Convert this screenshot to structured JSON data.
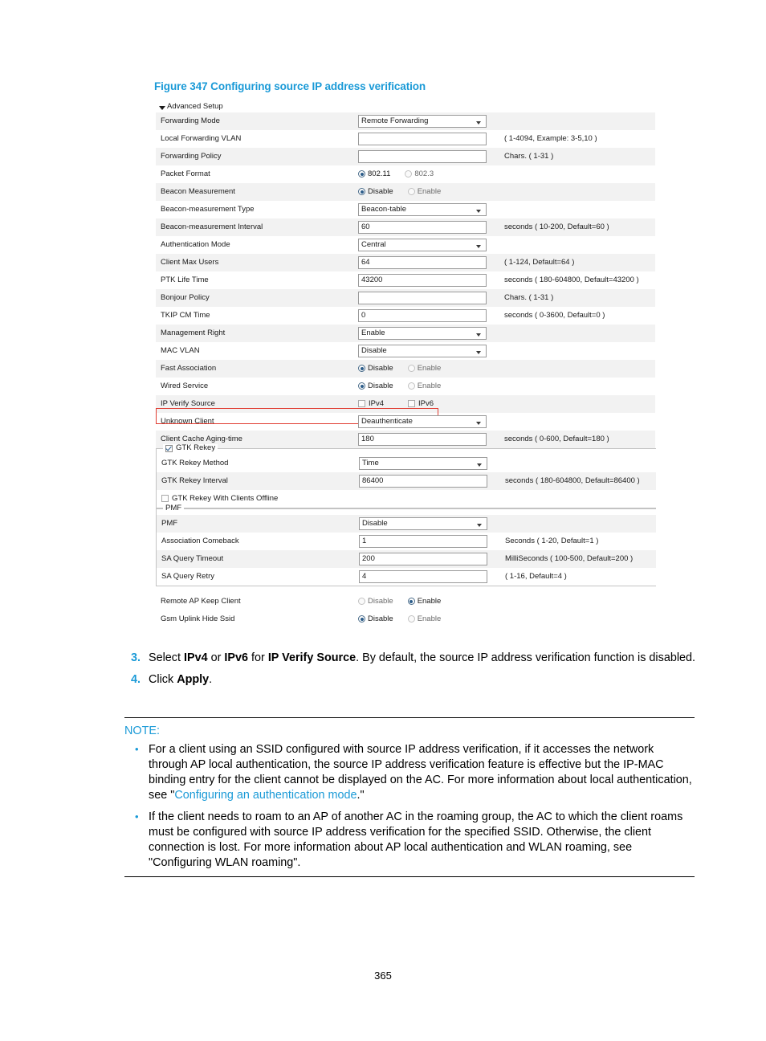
{
  "figure": {
    "caption": "Figure 347 Configuring source IP address verification"
  },
  "form": {
    "section_header": "Advanced Setup",
    "rows": [
      {
        "label": "Forwarding Mode",
        "control": "select",
        "value": "Remote Forwarding",
        "hint": ""
      },
      {
        "label": "Local Forwarding VLAN",
        "control": "text",
        "value": "",
        "hint": "( 1-4094, Example: 3-5,10 )"
      },
      {
        "label": "Forwarding Policy",
        "control": "text",
        "value": "",
        "hint": "Chars. ( 1-31 )"
      },
      {
        "label": "Packet Format",
        "control": "radio",
        "options": [
          "802.11",
          "802.3"
        ],
        "selected": "802.11",
        "hint": ""
      },
      {
        "label": "Beacon Measurement",
        "control": "radio",
        "options": [
          "Disable",
          "Enable"
        ],
        "selected": "Disable",
        "hint": ""
      },
      {
        "label": "Beacon-measurement Type",
        "control": "select",
        "value": "Beacon-table",
        "hint": ""
      },
      {
        "label": "Beacon-measurement Interval",
        "control": "text",
        "value": "60",
        "hint": "seconds ( 10-200, Default=60 )"
      },
      {
        "label": "Authentication Mode",
        "control": "select",
        "value": "Central",
        "hint": ""
      },
      {
        "label": "Client Max Users",
        "control": "text",
        "value": "64",
        "hint": "( 1-124, Default=64 )"
      },
      {
        "label": "PTK Life Time",
        "control": "text",
        "value": "43200",
        "hint": "seconds ( 180-604800, Default=43200 )"
      },
      {
        "label": "Bonjour Policy",
        "control": "text",
        "value": "",
        "hint": "Chars. ( 1-31 )"
      },
      {
        "label": "TKIP CM Time",
        "control": "text",
        "value": "0",
        "hint": "seconds ( 0-3600, Default=0 )"
      },
      {
        "label": "Management Right",
        "control": "select",
        "value": "Enable",
        "hint": ""
      },
      {
        "label": "MAC VLAN",
        "control": "select",
        "value": "Disable",
        "hint": ""
      },
      {
        "label": "Fast Association",
        "control": "radio",
        "options": [
          "Disable",
          "Enable"
        ],
        "selected": "Disable",
        "hint": ""
      },
      {
        "label": "Wired Service",
        "control": "radio",
        "options": [
          "Disable",
          "Enable"
        ],
        "selected": "Disable",
        "hint": ""
      },
      {
        "label": "IP Verify Source",
        "control": "checkbox",
        "options": [
          "IPv4",
          "IPv6"
        ],
        "checked": [],
        "hint": "",
        "highlighted": true
      },
      {
        "label": "Unknown Client",
        "control": "select",
        "value": "Deauthenticate",
        "hint": ""
      },
      {
        "label": "Client Cache Aging-time",
        "control": "text",
        "value": "180",
        "hint": "seconds ( 0-600, Default=180 )"
      }
    ],
    "gtk_rekey": {
      "legend": "GTK Rekey",
      "legend_checked": true,
      "rows": [
        {
          "label": "GTK Rekey Method",
          "control": "select",
          "value": "Time",
          "hint": ""
        },
        {
          "label": "GTK Rekey Interval",
          "control": "text",
          "value": "86400",
          "hint": "seconds ( 180-604800, Default=86400 )"
        }
      ],
      "offline_checkbox": {
        "label": "GTK Rekey With Clients Offline",
        "checked": false
      }
    },
    "pmf": {
      "legend": "PMF",
      "rows": [
        {
          "label": "PMF",
          "control": "select",
          "value": "Disable",
          "hint": ""
        },
        {
          "label": "Association Comeback",
          "control": "text",
          "value": "1",
          "hint": "Seconds ( 1-20, Default=1 )"
        },
        {
          "label": "SA Query Timeout",
          "control": "text",
          "value": "200",
          "hint": "MilliSeconds ( 100-500, Default=200 )"
        },
        {
          "label": "SA Query Retry",
          "control": "text",
          "value": "4",
          "hint": "( 1-16, Default=4 )"
        }
      ]
    },
    "tail_rows": [
      {
        "label": "Remote AP Keep Client",
        "control": "radio",
        "options": [
          "Disable",
          "Enable"
        ],
        "selected": "Enable"
      },
      {
        "label": "Gsm Uplink Hide Ssid",
        "control": "radio",
        "options": [
          "Disable",
          "Enable"
        ],
        "selected": "Disable"
      }
    ]
  },
  "steps": [
    {
      "num": "3.",
      "parts": [
        {
          "t": "Select ",
          "b": false
        },
        {
          "t": "IPv4",
          "b": true
        },
        {
          "t": " or ",
          "b": false
        },
        {
          "t": "IPv6",
          "b": true
        },
        {
          "t": " for ",
          "b": false
        },
        {
          "t": "IP Verify Source",
          "b": true
        },
        {
          "t": ". By default, the source IP address verification function is disabled.",
          "b": false
        }
      ]
    },
    {
      "num": "4.",
      "parts": [
        {
          "t": "Click ",
          "b": false
        },
        {
          "t": "Apply",
          "b": true
        },
        {
          "t": ".",
          "b": false
        }
      ]
    }
  ],
  "note": {
    "title": "NOTE:",
    "bullet_char": "•",
    "items": [
      {
        "parts": [
          {
            "t": "For a client using an SSID configured with source IP address verification, if it accesses the network through AP local authentication, the source IP address verification feature is effective but the IP-MAC binding entry for the client cannot be displayed on the AC. For more information about local authentication, see \"",
            "link": false
          },
          {
            "t": "Configuring an authentication mode",
            "link": true
          },
          {
            "t": ".\"",
            "link": false
          }
        ]
      },
      {
        "parts": [
          {
            "t": "If the client needs to roam to an AP of another AC in the roaming group, the AC to which the client roams must be configured with source IP address verification for the specified SSID. Otherwise, the client connection is lost. For more information about AP local authentication and WLAN roaming, see \"Configuring WLAN roaming\".",
            "link": false
          }
        ]
      }
    ]
  },
  "page": {
    "number": "365"
  },
  "colors": {
    "accent": "#1a9ad7",
    "highlight": "#e03c31",
    "row_alt": "#f2f2f2"
  }
}
